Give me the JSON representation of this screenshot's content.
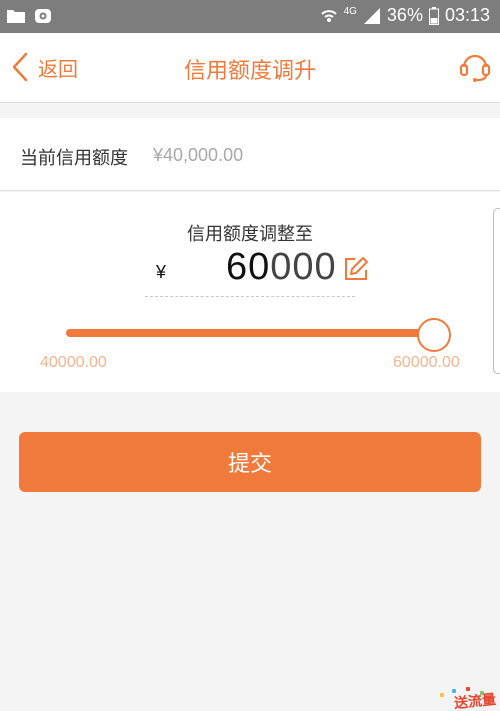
{
  "status_bar": {
    "network": "4G",
    "battery": "36%",
    "time": "03:13",
    "icons": [
      "folder-icon",
      "app-notification-icon",
      "wifi-icon",
      "signal-icon",
      "battery-icon"
    ]
  },
  "header": {
    "back_label": "返回",
    "title": "信用额度调升",
    "right_icon": "headset-icon"
  },
  "current_limit": {
    "label": "当前信用额度",
    "value": "¥40,000.00"
  },
  "adjust": {
    "label": "信用额度调整至",
    "currency_symbol": "¥",
    "amount_strong": "60",
    "amount_weak": "000",
    "min_label": "40000.00",
    "max_label": "60000.00",
    "slider_fraction": 1.0
  },
  "submit_label": "提交",
  "promo_text": "送流量",
  "colors": {
    "accent": "#f07a3c",
    "accent_light": "#f4b48e",
    "status_bar": "#7d7d7d",
    "page_bg": "#f4f4f4"
  }
}
